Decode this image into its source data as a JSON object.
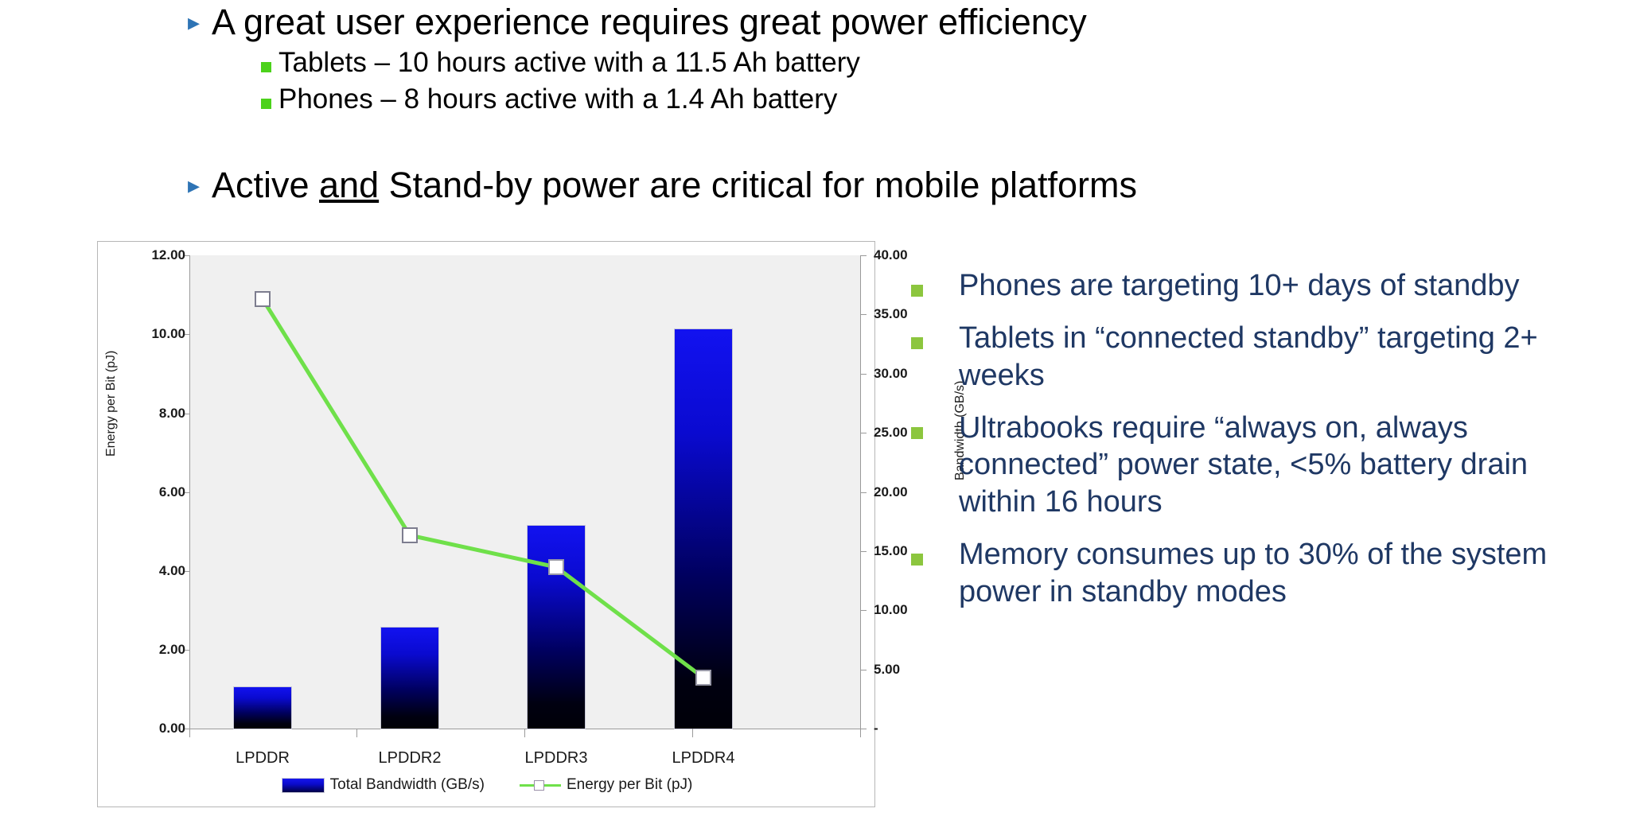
{
  "slide": {
    "top_bullets": [
      {
        "level": 1,
        "bullet_icon": "triangle-right-icon",
        "text": "A great user experience requires great power efficiency"
      },
      {
        "level": 2,
        "bullet_icon": "square-bullet-icon",
        "text": "Tablets – 10 hours active with a 11.5 Ah battery"
      },
      {
        "level": 2,
        "bullet_icon": "square-bullet-icon",
        "text": "Phones – 8 hours active with a 1.4 Ah battery"
      }
    ],
    "second_bullet": {
      "bullet_icon": "triangle-right-icon",
      "part_a": "Active ",
      "part_underlined": "and",
      "part_b": "  Stand-by power are critical for mobile platforms"
    },
    "right_column": [
      "Phones are targeting 10+ days of standby",
      "Tablets in “connected standby” targeting 2+ weeks",
      "Ultrabooks require “always on, always connected” power state, <5% battery drain within 16 hours",
      "Memory consumes up to 30% of the system power in standby modes"
    ]
  },
  "colors": {
    "level1_bullet": "#2E74B5",
    "level2_bullet": "#4CD21B",
    "right_bullet": "#8CC63E",
    "right_text": "#1F3864",
    "bar_top": "#1212F0",
    "bar_bottom": "#000008",
    "line": "#6FE04A",
    "marker_fill": "#FFFFFF",
    "plot_bg": "#F0F0F0"
  },
  "chart_data": {
    "type": "bar",
    "title": "",
    "categories": [
      "LPDDR",
      "LPDDR2",
      "LPDDR3",
      "LPDDR4"
    ],
    "series": [
      {
        "name": "Total Bandwidth (GB/s)",
        "type": "bar",
        "axis": "right",
        "values": [
          3.6,
          8.6,
          17.2,
          33.8
        ]
      },
      {
        "name": "Energy per Bit (pJ)",
        "type": "line",
        "axis": "left",
        "values": [
          10.9,
          4.9,
          4.1,
          1.3
        ]
      }
    ],
    "xlabel": "",
    "ylabel": "Energy per Bit (pJ)",
    "y2label": "Bandwidth (GB/s)",
    "ylim": [
      0,
      12
    ],
    "y2lim": [
      0,
      40
    ],
    "yticks": [
      "0.00",
      "2.00",
      "4.00",
      "6.00",
      "8.00",
      "10.00",
      "12.00"
    ],
    "y2ticks": [
      "-",
      "5.00",
      "10.00",
      "15.00",
      "20.00",
      "25.00",
      "30.00",
      "35.00",
      "40.00"
    ],
    "grid": false,
    "legend_position": "bottom",
    "legend": [
      "Total Bandwidth (GB/s)",
      "Energy per Bit (pJ)"
    ]
  }
}
